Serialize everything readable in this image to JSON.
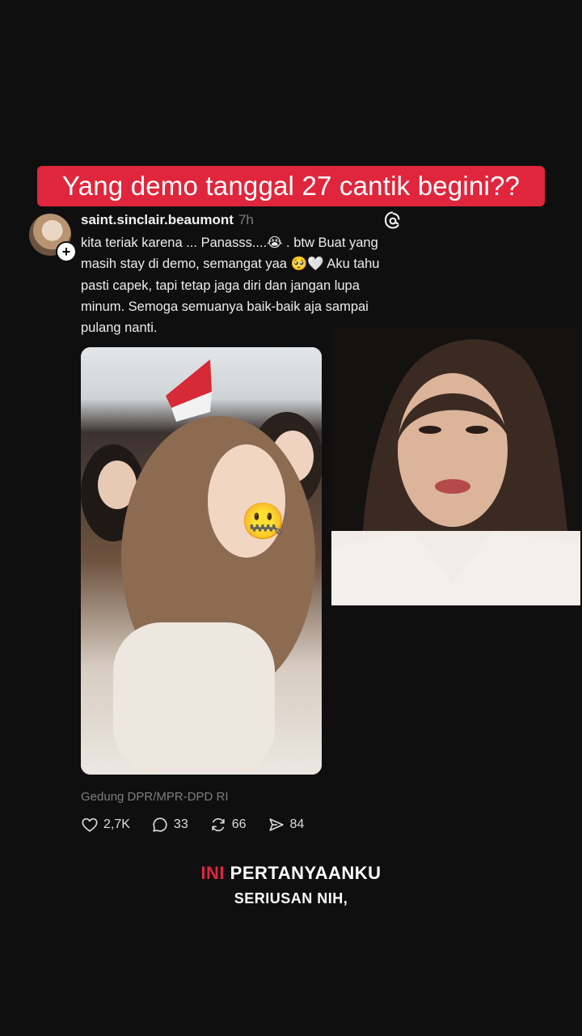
{
  "headline": "Yang demo tanggal 27 cantik begini??",
  "post": {
    "username": "saint.sinclair.beaumont",
    "time": "7h",
    "text": "kita teriak karena ... Panasss....😭 . btw Buat yang masih stay di demo, semangat yaa 🥺🤍 Aku tahu pasti capek, tapi tetap jaga diri dan jangan lupa minum. Semoga semuanya baik-baik aja sampai pulang nanti.",
    "sticker_emoji": "🤐",
    "location": "Gedung DPR/MPR-DPD RI",
    "likes": "2,7K",
    "comments": "33",
    "reposts": "66",
    "shares": "84"
  },
  "captions": {
    "highlight": "INI",
    "line1_rest": "PERTANYAANKU",
    "line2": "SERIUSAN NIH,"
  },
  "colors": {
    "accent": "#e0263c",
    "background": "#0f0f0f"
  }
}
